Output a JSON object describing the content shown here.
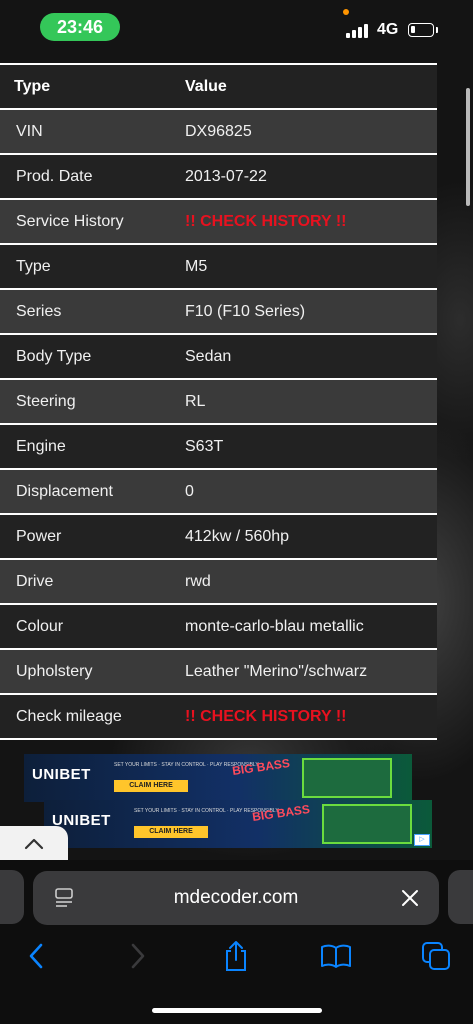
{
  "status": {
    "time": "23:46",
    "network": "4G",
    "battery_level": 0.2
  },
  "table": {
    "headers": [
      "Type",
      "Value"
    ],
    "rows": [
      {
        "type": "VIN",
        "value": "DX96825",
        "warning": false
      },
      {
        "type": "Prod. Date",
        "value": "2013-07-22",
        "warning": false
      },
      {
        "type": "Service History",
        "value": "!! CHECK HISTORY !!",
        "warning": true
      },
      {
        "type": "Type",
        "value": "M5",
        "warning": false
      },
      {
        "type": "Series",
        "value": "F10 (F10 Series)",
        "warning": false
      },
      {
        "type": "Body Type",
        "value": "Sedan",
        "warning": false
      },
      {
        "type": "Steering",
        "value": "RL",
        "warning": false
      },
      {
        "type": "Engine",
        "value": "S63T",
        "warning": false
      },
      {
        "type": "Displacement",
        "value": "0",
        "warning": false
      },
      {
        "type": "Power",
        "value": "412kw / 560hp",
        "warning": false
      },
      {
        "type": "Drive",
        "value": "rwd",
        "warning": false
      },
      {
        "type": "Colour",
        "value": "monte-carlo-blau metallic",
        "warning": false
      },
      {
        "type": "Upholstery",
        "value": "Leather \"Merino\"/schwarz",
        "warning": false
      },
      {
        "type": "Check mileage",
        "value": "!! CHECK HISTORY !!",
        "warning": true
      }
    ]
  },
  "ads": [
    {
      "brand": "UNIBET",
      "cta": "CLAIM HERE",
      "game": "BIG BASS"
    },
    {
      "brand": "UNIBET",
      "cta": "CLAIM HERE",
      "game": "BIG BASS"
    }
  ],
  "browser": {
    "url": "mdecoder.com"
  },
  "colors": {
    "warning": "#e8111f",
    "accent": "#0a84ff",
    "time_pill": "#34c759"
  }
}
